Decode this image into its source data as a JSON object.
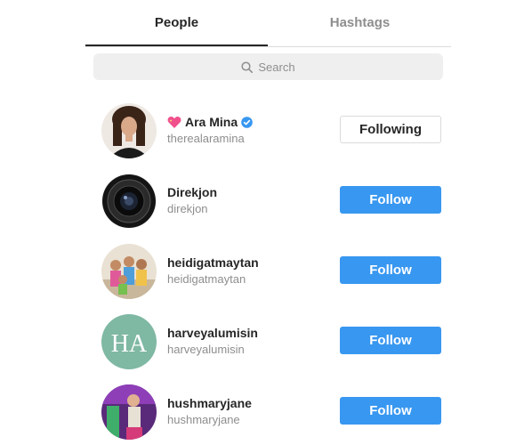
{
  "tabs": {
    "people": "People",
    "hashtags": "Hashtags"
  },
  "search": {
    "placeholder": "Search",
    "icon": "search-icon"
  },
  "accounts": [
    {
      "name": "Ara Mina",
      "handle": "therealaramina",
      "button": "Following",
      "following": true,
      "verified": true,
      "emoji": "sparkling-heart"
    },
    {
      "name": "Direkjon",
      "handle": "direkjon",
      "button": "Follow",
      "following": false
    },
    {
      "name": "heidigatmaytan",
      "handle": "heidigatmaytan",
      "button": "Follow",
      "following": false
    },
    {
      "name": "harveyalumisin",
      "handle": "harveyalumisin",
      "button": "Follow",
      "following": false
    },
    {
      "name": "hushmaryjane",
      "handle": "hushmaryjane",
      "button": "Follow",
      "following": false
    }
  ],
  "avatars": {
    "harveyalumisin_logo": "HA"
  },
  "colors": {
    "follow_blue": "#3897f0",
    "verified_blue": "#3897f0",
    "logo_green": "#7fb8a3"
  }
}
